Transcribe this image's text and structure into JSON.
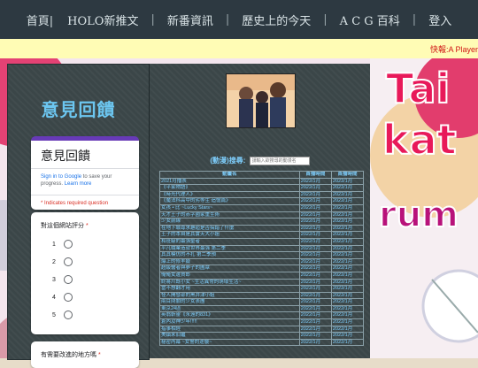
{
  "nav": {
    "items": [
      "首頁|",
      "HOLO新推文",
      "新番資訊",
      "歷史上的今天",
      "A C G 百科",
      "登入"
    ],
    "separator": "|"
  },
  "marquee": {
    "text": "快報:A Player"
  },
  "left": {
    "heading": "意見回饋",
    "form_title": "意見回饋",
    "signin_link": "Sign in to Google",
    "signin_rest": "to save your progress.",
    "learn_more": "Learn more",
    "required_note": "* Indicates required question",
    "rating_question": "對這個網站評分",
    "rating_options": [
      "1",
      "2",
      "3",
      "4",
      "5"
    ],
    "next_question": "有需要改進的地方嗎"
  },
  "main": {
    "search_label": "(動漫)搜尋:",
    "search_placeholder": "請輸入欲搜尋的動漫名",
    "table": {
      "headers": [
        "動畫名",
        "首播時間",
        "首播時間"
      ],
      "rows": [
        [
          "2021月播表",
          "2022/1月",
          "2022/1月"
        ],
        [
          "《平家物語》",
          "2022/1月",
          "2022/1月"
        ],
        [
          "《時光代理人》",
          "2022/1月",
          "2022/1月"
        ],
        [
          "《魔法科高中的劣等生 追憶篇》",
          "2022/1月",
          "2022/1月"
        ],
        [
          "女孩 • 比 ~Lucky Stars~",
          "2022/1月",
          "2022/1月"
        ],
        [
          "天才王子的赤字國家重生術",
          "2022/1月",
          "2022/1月"
        ],
        [
          "少女前線",
          "2022/1月",
          "2022/1月"
        ],
        [
          "在地下城尋求邂逅是否搞錯了什麼",
          "2022/1月",
          "2022/1月"
        ],
        [
          "王子的本自是其實天大小姐",
          "2022/1月",
          "2022/1月"
        ],
        [
          "和班級的最強聖者",
          "2022/1月",
          "2022/1月"
        ],
        [
          "平凡職業造就世界最強 第二季",
          "2022/1月",
          "2022/1月"
        ],
        [
          "其其模仿的不扎 第二季預",
          "2022/1月",
          "2022/1月"
        ],
        [
          "爆上的修羊籤",
          "2022/1月",
          "2022/1月"
        ],
        [
          "超級醫者與夢子的圖章",
          "2022/1月",
          "2022/1月"
        ],
        [
          "俺俺女邊貨郎",
          "2022/1月",
          "2022/1月"
        ],
        [
          "終將川既小女 ~生活異常的萌壞生活~",
          "2022/1月",
          "2022/1月"
        ],
        [
          "當不想翻才用",
          "2022/1月",
          "2022/1月"
        ],
        [
          "怪人開發部的黑井津小姐",
          "2022/1月",
          "2022/1月"
        ],
        [
          "兩目問關的少女表團",
          "2022/1月",
          "2022/1月"
        ],
        [
          "東京24區",
          "2022/1月",
          "2022/1月"
        ],
        [
          "英翁斬靈《永遠的831》",
          "2022/1月",
          "2022/1月"
        ],
        [
          "蒼內及神少年!!!!!",
          "2022/1月",
          "2022/1月"
        ],
        [
          "指事相經",
          "2022/1月",
          "2022/1月"
        ],
        [
          "美鎮末旧繼",
          "2022/1月",
          "2022/1月"
        ],
        [
          "秘密內幕 ~女警的逆襲~",
          "2022/1月",
          "2022/1月"
        ]
      ]
    }
  },
  "colors": {
    "nav_bg": "#2d3941",
    "marquee_bg": "#fffcb5",
    "marquee_text": "#d01515",
    "panel_bg": "#3b4648",
    "heading_blue": "#6cc6f0",
    "table_text": "#7fd0ff",
    "form_accent": "#673ab7"
  }
}
